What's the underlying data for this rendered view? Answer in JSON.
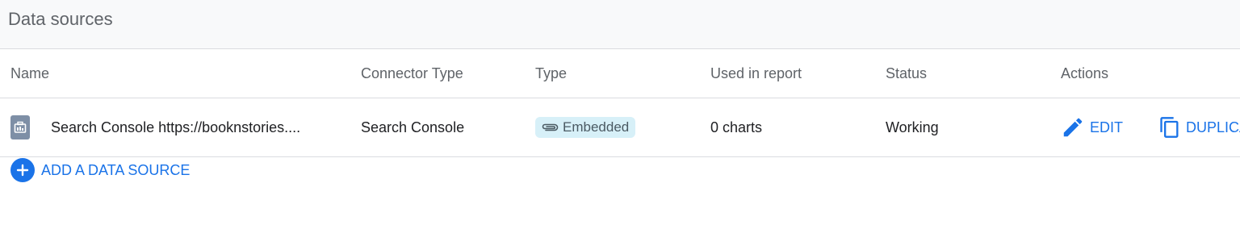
{
  "header": {
    "title": "Data sources"
  },
  "table": {
    "columns": {
      "name": "Name",
      "connector": "Connector Type",
      "type": "Type",
      "used": "Used in report",
      "status": "Status",
      "actions": "Actions"
    },
    "rows": [
      {
        "icon": "search-console-icon",
        "name": "Search Console https://booknstories....",
        "connector": "Search Console",
        "type": "Embedded",
        "type_icon": "paperclip-icon",
        "used": "0 charts",
        "status": "Working",
        "actions": [
          {
            "label": "EDIT",
            "icon": "pencil-icon"
          },
          {
            "label": "DUPLICA",
            "icon": "copy-icon"
          }
        ]
      }
    ]
  },
  "add_source": {
    "label": "ADD A DATA SOURCE",
    "icon": "plus-circle-icon"
  },
  "colors": {
    "accent": "#1a73e8",
    "chip_bg": "#d7f0f8",
    "header_bg": "#f8f9fa"
  }
}
